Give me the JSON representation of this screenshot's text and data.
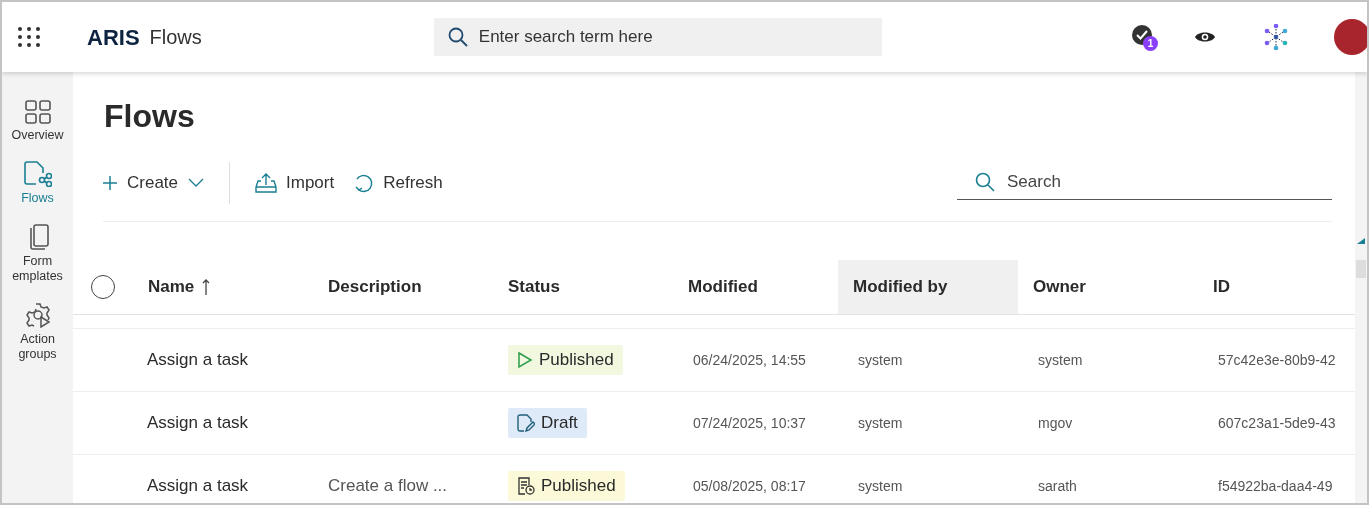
{
  "app": {
    "brand": "ARIS",
    "product": "Flows"
  },
  "search": {
    "placeholder": "Enter search term here"
  },
  "header": {
    "notifications": {
      "badge": "1"
    }
  },
  "sidebar": {
    "items": [
      {
        "label": "Overview",
        "kind": "overview",
        "selected": false
      },
      {
        "label": "Flows",
        "kind": "flows",
        "selected": true
      },
      {
        "label": "Form emplates",
        "kind": "forms",
        "selected": false
      },
      {
        "label": "Action groups",
        "kind": "actions",
        "selected": false
      }
    ]
  },
  "page": {
    "title": "Flows"
  },
  "toolbar": {
    "create": "Create",
    "import": "Import",
    "refresh": "Refresh",
    "search_placeholder": "Search"
  },
  "table": {
    "select_all": {
      "checked": false
    },
    "columns": [
      {
        "label": "Name",
        "sorted": true,
        "highlighted": false
      },
      {
        "label": "Description",
        "sorted": false,
        "highlighted": false
      },
      {
        "label": "Status",
        "sorted": false,
        "highlighted": false
      },
      {
        "label": "Modified",
        "sorted": false,
        "highlighted": false
      },
      {
        "label": "Modified by",
        "sorted": false,
        "highlighted": true
      },
      {
        "label": "Owner",
        "sorted": false,
        "highlighted": false
      },
      {
        "label": "ID",
        "sorted": false,
        "highlighted": false
      }
    ],
    "rows": [
      {
        "name": "Assign a task",
        "description": "",
        "status": {
          "label": "Published",
          "kind": "published"
        },
        "modified": "06/24/2025, 14:55",
        "modified_by": "system",
        "owner": "system",
        "id": "57c42e3e-80b9-42"
      },
      {
        "name": "Assign a task",
        "description": "",
        "status": {
          "label": "Draft",
          "kind": "draft"
        },
        "modified": "07/24/2025, 10:37",
        "modified_by": "system",
        "owner": "mgov",
        "id": "607c23a1-5de9-43"
      },
      {
        "name": "Assign a task",
        "description": "Create a flow ...",
        "status": {
          "label": "Published",
          "kind": "scheduled"
        },
        "modified": "05/08/2025, 08:17",
        "modified_by": "system",
        "owner": "sarath",
        "id": "f54922ba-daa4-49"
      }
    ]
  }
}
